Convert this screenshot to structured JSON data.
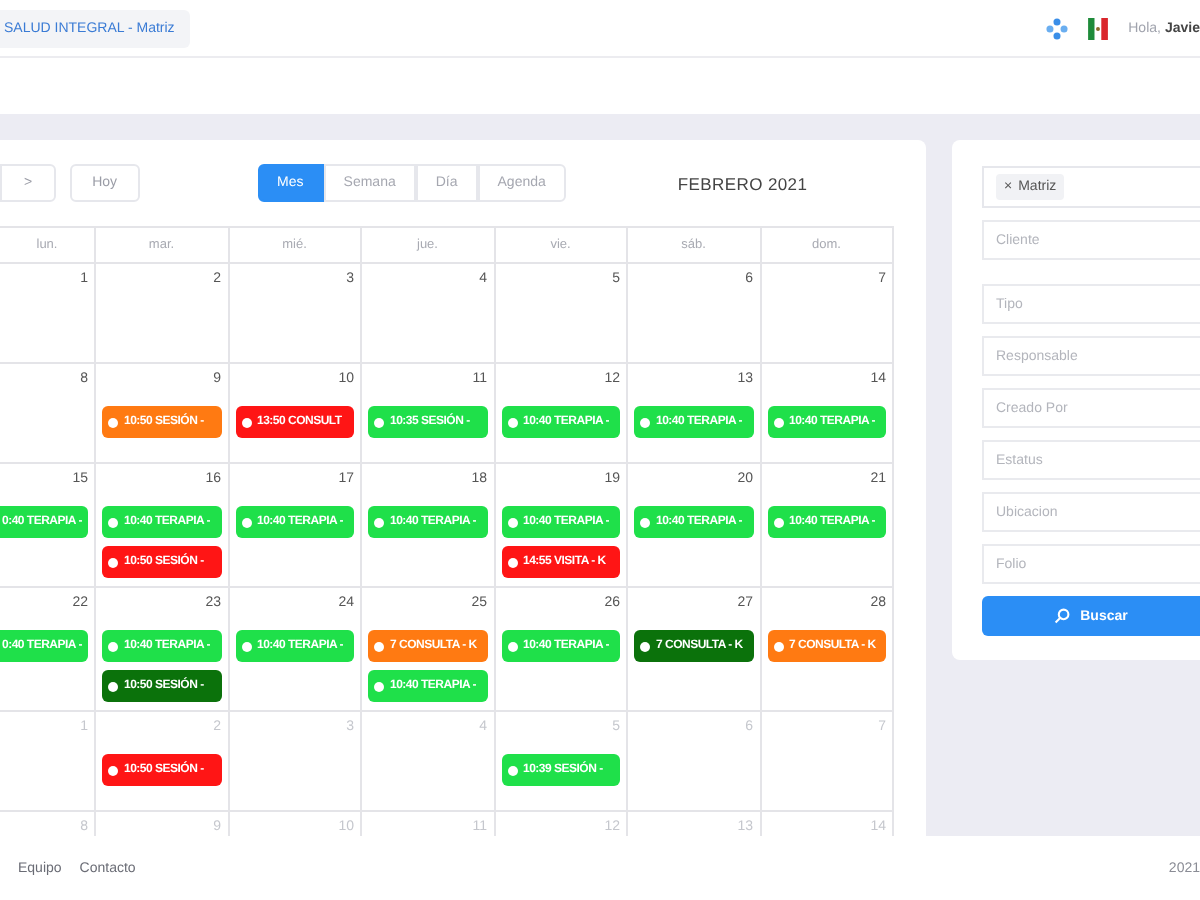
{
  "header": {
    "company": "SALUD INTEGRAL - Matriz",
    "greeting": "Hola,",
    "user_name": "Javie"
  },
  "calendar": {
    "toolbar": {
      "next": ">",
      "today": "Hoy",
      "title": "FEBRERO 2021"
    },
    "views": [
      {
        "label": "Mes",
        "selected": true
      },
      {
        "label": "Semana",
        "selected": false
      },
      {
        "label": "Día",
        "selected": false
      },
      {
        "label": "Agenda",
        "selected": false
      }
    ],
    "weekdays": [
      "lun.",
      "mar.",
      "mié.",
      "jue.",
      "vie.",
      "sáb.",
      "dom."
    ],
    "weeks": [
      {
        "days": [
          {
            "number": "1",
            "other_month": false
          },
          {
            "number": "2",
            "other_month": false
          },
          {
            "number": "3",
            "other_month": false
          },
          {
            "number": "4",
            "other_month": false
          },
          {
            "number": "5",
            "other_month": false
          },
          {
            "number": "6",
            "other_month": false
          },
          {
            "number": "7",
            "other_month": false
          }
        ]
      },
      {
        "days": [
          {
            "number": "8",
            "other_month": false
          },
          {
            "number": "9",
            "other_month": false,
            "events": [
              {
                "label": "10:50 SESIÓN -",
                "color": "#ff7a12",
                "clipped": false
              }
            ]
          },
          {
            "number": "10",
            "other_month": false,
            "events": [
              {
                "label": "13:50 CONSULT",
                "color": "#ff1515",
                "clipped": false
              }
            ]
          },
          {
            "number": "11",
            "other_month": false,
            "events": [
              {
                "label": "10:35 SESIÓN -",
                "color": "#1fe04a",
                "clipped": false
              }
            ]
          },
          {
            "number": "12",
            "other_month": false,
            "events": [
              {
                "label": "10:40 TERAPIA -",
                "color": "#1fe04a",
                "clipped": false
              }
            ]
          },
          {
            "number": "13",
            "other_month": false,
            "events": [
              {
                "label": "10:40 TERAPIA -",
                "color": "#1fe04a",
                "clipped": false
              }
            ]
          },
          {
            "number": "14",
            "other_month": false,
            "events": [
              {
                "label": "10:40 TERAPIA -",
                "color": "#1fe04a",
                "clipped": false
              }
            ]
          }
        ]
      },
      {
        "days": [
          {
            "number": "15",
            "other_month": false,
            "events": [
              {
                "label": "0:40 TERAPIA -",
                "color": "#1fe04a",
                "clipped": true
              }
            ]
          },
          {
            "number": "16",
            "other_month": false,
            "events": [
              {
                "label": "10:40 TERAPIA -",
                "color": "#1fe04a",
                "clipped": false
              },
              {
                "label": "10:50 SESIÓN -",
                "color": "#ff1515",
                "clipped": false
              }
            ]
          },
          {
            "number": "17",
            "other_month": false,
            "events": [
              {
                "label": "10:40 TERAPIA -",
                "color": "#1fe04a",
                "clipped": false
              }
            ]
          },
          {
            "number": "18",
            "other_month": false,
            "events": [
              {
                "label": "10:40 TERAPIA -",
                "color": "#1fe04a",
                "clipped": false
              }
            ]
          },
          {
            "number": "19",
            "other_month": false,
            "events": [
              {
                "label": "10:40 TERAPIA -",
                "color": "#1fe04a",
                "clipped": false
              },
              {
                "label": "14:55 VISITA - K",
                "color": "#ff1515",
                "clipped": false
              }
            ]
          },
          {
            "number": "20",
            "other_month": false,
            "events": [
              {
                "label": "10:40 TERAPIA -",
                "color": "#1fe04a",
                "clipped": false
              }
            ]
          },
          {
            "number": "21",
            "other_month": false,
            "events": [
              {
                "label": "10:40 TERAPIA -",
                "color": "#1fe04a",
                "clipped": false
              }
            ]
          }
        ]
      },
      {
        "days": [
          {
            "number": "22",
            "other_month": false,
            "events": [
              {
                "label": "0:40 TERAPIA -",
                "color": "#1fe04a",
                "clipped": true
              }
            ]
          },
          {
            "number": "23",
            "other_month": false,
            "events": [
              {
                "label": "10:40 TERAPIA -",
                "color": "#1fe04a",
                "clipped": false
              },
              {
                "label": "10:50 SESIÓN -",
                "color": "#0b720b",
                "clipped": false
              }
            ]
          },
          {
            "number": "24",
            "other_month": false,
            "events": [
              {
                "label": "10:40 TERAPIA -",
                "color": "#1fe04a",
                "clipped": false
              }
            ]
          },
          {
            "number": "25",
            "other_month": false,
            "events": [
              {
                "label": "7 CONSULTA - K",
                "color": "#ff7a12",
                "clipped": false
              },
              {
                "label": "10:40 TERAPIA -",
                "color": "#1fe04a",
                "clipped": false
              }
            ]
          },
          {
            "number": "26",
            "other_month": false,
            "events": [
              {
                "label": "10:40 TERAPIA -",
                "color": "#1fe04a",
                "clipped": false
              }
            ]
          },
          {
            "number": "27",
            "other_month": false,
            "events": [
              {
                "label": "7 CONSULTA - K",
                "color": "#0b720b",
                "clipped": false
              }
            ]
          },
          {
            "number": "28",
            "other_month": false,
            "events": [
              {
                "label": "7 CONSULTA - K",
                "color": "#ff7a12",
                "clipped": false
              }
            ]
          }
        ]
      },
      {
        "days": [
          {
            "number": "1",
            "other_month": true
          },
          {
            "number": "2",
            "other_month": true,
            "events": [
              {
                "label": "10:50 SESIÓN -",
                "color": "#ff1515",
                "clipped": false
              }
            ]
          },
          {
            "number": "3",
            "other_month": true
          },
          {
            "number": "4",
            "other_month": true
          },
          {
            "number": "5",
            "other_month": true,
            "events": [
              {
                "label": "10:39 SESIÓN -",
                "color": "#1fe04a",
                "clipped": false
              }
            ]
          },
          {
            "number": "6",
            "other_month": true
          },
          {
            "number": "7",
            "other_month": true
          }
        ]
      },
      {
        "days": [
          {
            "number": "8",
            "other_month": true
          },
          {
            "number": "9",
            "other_month": true
          },
          {
            "number": "10",
            "other_month": true
          },
          {
            "number": "11",
            "other_month": true
          },
          {
            "number": "12",
            "other_month": true
          },
          {
            "number": "13",
            "other_month": true
          },
          {
            "number": "14",
            "other_month": true
          }
        ]
      }
    ]
  },
  "filters": {
    "tag": {
      "label": "Matriz",
      "remove": "×"
    },
    "fields": [
      {
        "placeholder": "Cliente"
      },
      {
        "placeholder": "Tipo"
      },
      {
        "placeholder": "Responsable"
      },
      {
        "placeholder": "Creado Por"
      },
      {
        "placeholder": "Estatus"
      },
      {
        "placeholder": "Ubicacion"
      },
      {
        "placeholder": "Folio"
      }
    ],
    "search_button": "Buscar"
  },
  "footer": {
    "links": [
      "Equipo",
      "Contacto"
    ],
    "year": "2021"
  }
}
